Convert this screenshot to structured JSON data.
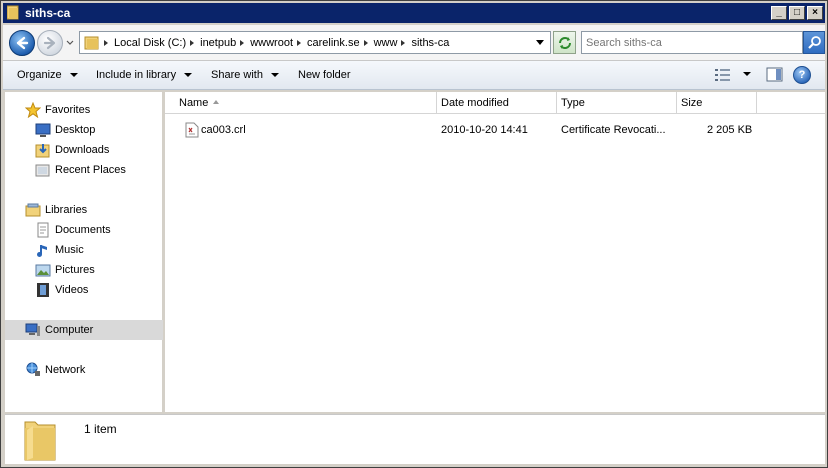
{
  "window": {
    "title": "siths-ca"
  },
  "titlebar_buttons": {
    "minimize": "_",
    "maximize": "□",
    "close": "×"
  },
  "address": {
    "crumbs": [
      "Local Disk (C:)",
      "inetpub",
      "wwwroot",
      "carelink.se",
      "www",
      "siths-ca"
    ]
  },
  "search": {
    "placeholder": "Search siths-ca"
  },
  "toolbar": {
    "organize": "Organize",
    "include_in_library": "Include in library",
    "share_with": "Share with",
    "new_folder": "New folder",
    "help": "?"
  },
  "sidebar": {
    "favorites": "Favorites",
    "desktop": "Desktop",
    "downloads": "Downloads",
    "recent_places": "Recent Places",
    "libraries": "Libraries",
    "documents": "Documents",
    "music": "Music",
    "pictures": "Pictures",
    "videos": "Videos",
    "computer": "Computer",
    "network": "Network"
  },
  "columns": {
    "name": "Name",
    "date_modified": "Date modified",
    "type": "Type",
    "size": "Size"
  },
  "files": [
    {
      "name": "ca003.crl",
      "date_modified": "2010-10-20 14:41",
      "type": "Certificate Revocati...",
      "size": "2 205 KB"
    }
  ],
  "status": {
    "item_count": "1 item"
  },
  "colors": {
    "titlebar": "#0a246a",
    "selection": "#d9d9d9",
    "folder": "#e9c766"
  }
}
